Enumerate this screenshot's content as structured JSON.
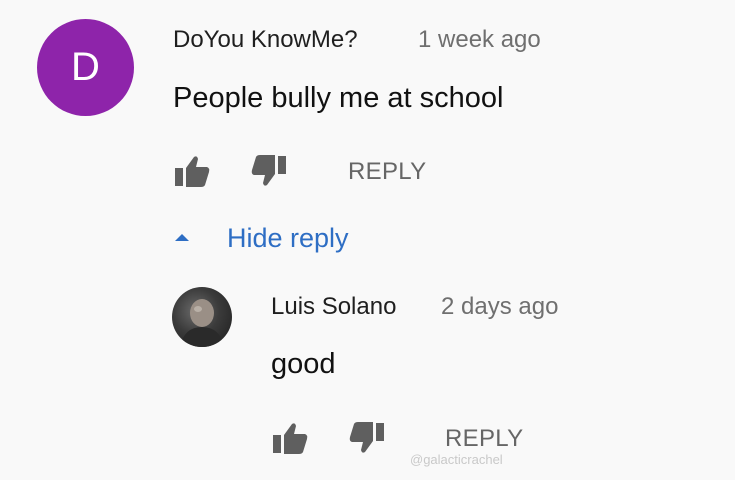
{
  "comment": {
    "avatar_letter": "D",
    "author": "DoYou KnowMe?",
    "time": "1 week ago",
    "text": "People bully me at school",
    "reply_label": "REPLY"
  },
  "toggle": {
    "label": "Hide reply"
  },
  "reply": {
    "author": "Luis Solano",
    "time": "2 days ago",
    "text": "good",
    "reply_label": "REPLY"
  },
  "watermark": "@galacticrachel",
  "icons": {
    "like": "thumbs-up-icon",
    "dislike": "thumbs-down-icon",
    "collapse": "caret-up-icon"
  },
  "colors": {
    "avatar_bg": "#8e24aa",
    "link": "#2e6ec4",
    "icon": "#5f5f5f"
  }
}
